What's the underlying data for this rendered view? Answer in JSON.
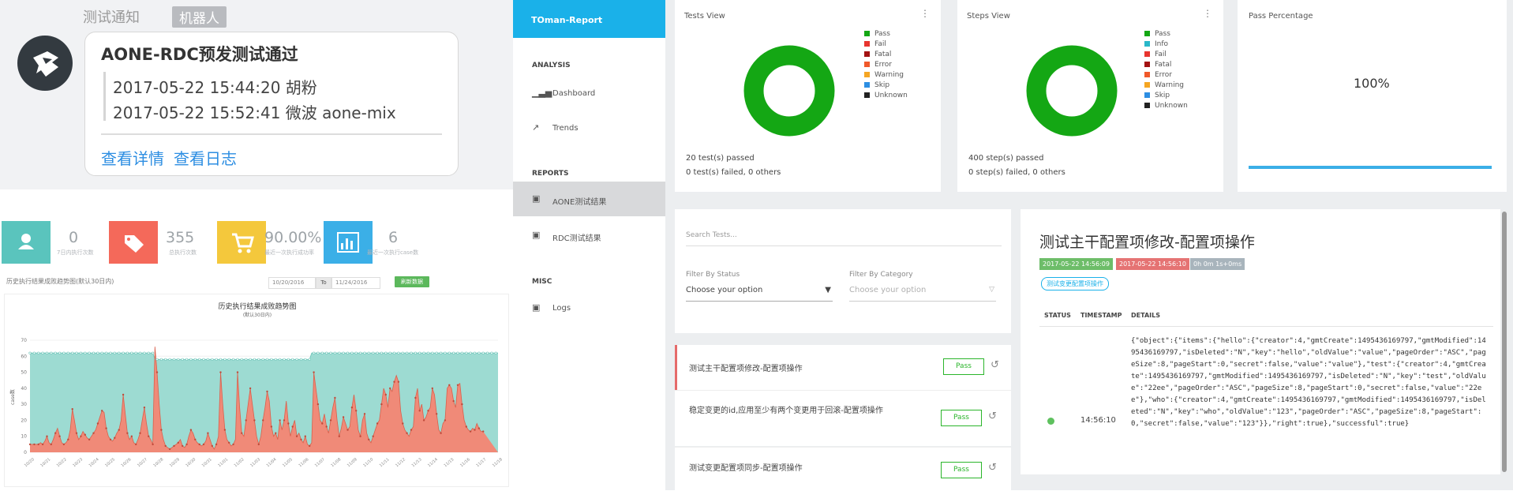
{
  "notification": {
    "title": "测试通知",
    "badge": "机器人",
    "card_title": "AONE-RDC预发测试通过",
    "lines": [
      "2017-05-22 15:44:20 胡粉",
      "2017-05-22 15:52:41 微波 aone-mix"
    ],
    "links": [
      "查看详情",
      "查看日志"
    ]
  },
  "stats": {
    "cards": [
      {
        "icon": "user-icon",
        "color": "#5ac4bd",
        "value": "0",
        "label": "7日内执行次数"
      },
      {
        "icon": "tag-icon",
        "color": "#f4695a",
        "value": "355",
        "label": "总执行次数"
      },
      {
        "icon": "cart-icon",
        "color": "#f4c83c",
        "value": "90.00%",
        "label": "最近一次执行成功率"
      },
      {
        "icon": "chart-icon",
        "color": "#3bafe7",
        "value": "6",
        "label": "最近一次执行case数"
      }
    ],
    "range_caption": "历史执行结果成败趋势图(默认30日内)",
    "date_from": "10/20/2016",
    "to_label": "To",
    "date_to": "11/24/2016",
    "query_button": "刷新数据"
  },
  "chart_data": {
    "type": "area",
    "title": "历史执行结果成败趋势图",
    "subtitle": "(默认30日内)",
    "ylabel": "case数",
    "ylim": [
      0,
      70
    ],
    "yticks": [
      0,
      10,
      20,
      30,
      40,
      50,
      60,
      70
    ],
    "colors": {
      "total": "#9ddbd2",
      "failed": "#f08a78"
    },
    "series": [
      {
        "name": "",
        "values": [
          62,
          62,
          62,
          62,
          62,
          62,
          62,
          62,
          62,
          62,
          62,
          62,
          62,
          62,
          62,
          62,
          62,
          62,
          62,
          62,
          62,
          62,
          62,
          62,
          62,
          62,
          62,
          62,
          62,
          62,
          62,
          62,
          62,
          62,
          62,
          62,
          62,
          62,
          62,
          62,
          62,
          62,
          62,
          62,
          62,
          62,
          62,
          62,
          62,
          62,
          62,
          62,
          62,
          62,
          62,
          62,
          62,
          62,
          62,
          58,
          58,
          58,
          58,
          58,
          58,
          58,
          58,
          58,
          58,
          58,
          58,
          58,
          58,
          58,
          58,
          58,
          58,
          58,
          58,
          58,
          58,
          58,
          58,
          58,
          58,
          58,
          58,
          58,
          58,
          58,
          58,
          58,
          58,
          58,
          58,
          58,
          58,
          58,
          58,
          58,
          58,
          58,
          58,
          58,
          58,
          58,
          58,
          58,
          58,
          58,
          58,
          58,
          58,
          58,
          58,
          58,
          58,
          58,
          58,
          58,
          58,
          58,
          58,
          58,
          58,
          58,
          58,
          58,
          58,
          58,
          58,
          58,
          58,
          62,
          62,
          62,
          62,
          62,
          62,
          62,
          62,
          62,
          62,
          62,
          62,
          62,
          62,
          62,
          62,
          62,
          62,
          62,
          62,
          62,
          62,
          62,
          62,
          62,
          62,
          62,
          62,
          62,
          62,
          62,
          62,
          62,
          62,
          62,
          62,
          62,
          62,
          62,
          62,
          62,
          62,
          62,
          62,
          62,
          62,
          62,
          62,
          62,
          62,
          62,
          62,
          62,
          62,
          62,
          62,
          62,
          62,
          62,
          62,
          62,
          62,
          62,
          62,
          62,
          62,
          62,
          62,
          62,
          62,
          62,
          62,
          62,
          62,
          62,
          62,
          62,
          62,
          62,
          62,
          62,
          62,
          62,
          62,
          62,
          62,
          62,
          62,
          62
        ]
      },
      {
        "name": "",
        "values": [
          5,
          5,
          5,
          5,
          5,
          6,
          5,
          7,
          10,
          6,
          5,
          8,
          12,
          15,
          10,
          6,
          5,
          6,
          8,
          14,
          27,
          20,
          12,
          8,
          10,
          13,
          11,
          9,
          8,
          10,
          12,
          14,
          18,
          22,
          26,
          25,
          15,
          10,
          8,
          7,
          9,
          12,
          14,
          20,
          36,
          24,
          12,
          8,
          10,
          6,
          5,
          8,
          12,
          20,
          28,
          18,
          10,
          8,
          5,
          66,
          50,
          30,
          14,
          8,
          4,
          3,
          2,
          3,
          4,
          5,
          6,
          8,
          4,
          3,
          5,
          10,
          14,
          12,
          8,
          6,
          5,
          4,
          5,
          7,
          12,
          8,
          4,
          2,
          5,
          10,
          50,
          30,
          14,
          8,
          6,
          4,
          5,
          8,
          50,
          28,
          12,
          10,
          20,
          30,
          40,
          30,
          20,
          10,
          5,
          10,
          20,
          28,
          38,
          32,
          16,
          10,
          12,
          8,
          20,
          14,
          20,
          32,
          18,
          10,
          16,
          20,
          10,
          12,
          8,
          6,
          10,
          5,
          4,
          6,
          50,
          40,
          30,
          20,
          18,
          24,
          16,
          12,
          20,
          28,
          34,
          20,
          10,
          15,
          22,
          18,
          14,
          16,
          28,
          36,
          26,
          14,
          10,
          20,
          24,
          12,
          8,
          6,
          10,
          14,
          18,
          20,
          30,
          40,
          36,
          28,
          40,
          38,
          44,
          48,
          44,
          26,
          18,
          14,
          12,
          10,
          14,
          16,
          34,
          40,
          26,
          30,
          20,
          22,
          26,
          28,
          40,
          36,
          24,
          14,
          12,
          18,
          20,
          40,
          42,
          40,
          32,
          28,
          42,
          43,
          30,
          20,
          16,
          14,
          13,
          15,
          14,
          18,
          15,
          13,
          13
        ]
      }
    ],
    "xlabels": [
      "10/20",
      "10/21",
      "10/22",
      "10/23",
      "10/24",
      "10/25",
      "10/26",
      "10/27",
      "10/28",
      "10/29",
      "10/30",
      "10/31",
      "11/01",
      "11/02",
      "11/03",
      "11/04",
      "11/05",
      "11/06",
      "11/07",
      "11/08",
      "11/09",
      "11/10",
      "11/11",
      "11/12",
      "11/13",
      "11/14",
      "11/15",
      "11/16",
      "11/17",
      "11/18"
    ]
  },
  "report": {
    "brand": "TOman-Report",
    "sidebar": {
      "analysis_label": "ANALYSIS",
      "dashboard": "Dashboard",
      "trends": "Trends",
      "reports_label": "REPORTS",
      "aone": "AONE测试结果",
      "rdc": "RDC测试结果",
      "misc_label": "MISC",
      "logs": "Logs"
    },
    "tests_view": {
      "title": "Tests View",
      "legend": [
        {
          "label": "Pass",
          "color": "#14a714"
        },
        {
          "label": "Fail",
          "color": "#e8352f"
        },
        {
          "label": "Fatal",
          "color": "#a31212"
        },
        {
          "label": "Error",
          "color": "#f0592a"
        },
        {
          "label": "Warning",
          "color": "#f5a623"
        },
        {
          "label": "Skip",
          "color": "#2d8ee2"
        },
        {
          "label": "Unknown",
          "color": "#222222"
        }
      ],
      "passed_text": "20 test(s) passed",
      "failed_text": "0 test(s) failed, 0 others",
      "pass_fraction": 1
    },
    "steps_view": {
      "title": "Steps View",
      "legend": [
        {
          "label": "Pass",
          "color": "#14a714"
        },
        {
          "label": "Info",
          "color": "#29b8c9"
        },
        {
          "label": "Fail",
          "color": "#e8352f"
        },
        {
          "label": "Fatal",
          "color": "#a31212"
        },
        {
          "label": "Error",
          "color": "#f0592a"
        },
        {
          "label": "Warning",
          "color": "#f5a623"
        },
        {
          "label": "Skip",
          "color": "#2d8ee2"
        },
        {
          "label": "Unknown",
          "color": "#222222"
        }
      ],
      "passed_text": "400 step(s) passed",
      "failed_text": "0 step(s) failed, 0 others",
      "pass_fraction": 1
    },
    "pass_percentage": {
      "title": "Pass Percentage",
      "value": "100%",
      "fraction": 1
    },
    "filters": {
      "search_placeholder": "Search Tests...",
      "status_label": "Filter By Status",
      "status_value": "Choose your option",
      "category_label": "Filter By Category",
      "category_value": "Choose your option"
    },
    "tests": [
      {
        "name": "测试主干配置项修改-配置项操作",
        "status": "Pass"
      },
      {
        "name": "稳定变更的id,应用至少有两个变更用于回滚-配置项操作",
        "status": "Pass"
      },
      {
        "name": "测试变更配置项同步-配置项操作",
        "status": "Pass"
      }
    ],
    "detail": {
      "title": "测试主干配置项修改-配置项操作",
      "tag_start": "2017-05-22 14:56:09",
      "tag_end": "2017-05-22 14:56:10",
      "tag_duration": "0h 0m 1s+0ms",
      "category": "测试变更配置项操作",
      "col_status": "STATUS",
      "col_timestamp": "TIMESTAMP",
      "col_details": "DETAILS",
      "row_timestamp": "14:56:10",
      "row_details": "{\"object\":{\"items\":{\"hello\":{\"creator\":4,\"gmtCreate\":1495436169797,\"gmtModified\":1495436169797,\"isDeleted\":\"N\",\"key\":\"hello\",\"oldValue\":\"value\",\"pageOrder\":\"ASC\",\"pageSize\":8,\"pageStart\":0,\"secret\":false,\"value\":\"value\"},\"test\":{\"creator\":4,\"gmtCreate\":1495436169797,\"gmtModified\":1495436169797,\"isDeleted\":\"N\",\"key\":\"test\",\"oldValue\":\"22ee\",\"pageOrder\":\"ASC\",\"pageSize\":8,\"pageStart\":0,\"secret\":false,\"value\":\"22ee\"},\"who\":{\"creator\":4,\"gmtCreate\":1495436169797,\"gmtModified\":1495436169797,\"isDeleted\":\"N\",\"key\":\"who\",\"oldValue\":\"123\",\"pageOrder\":\"ASC\",\"pageSize\":8,\"pageStart\":0,\"secret\":false,\"value\":\"123\"}},\"right\":true},\"successful\":true}"
    }
  }
}
